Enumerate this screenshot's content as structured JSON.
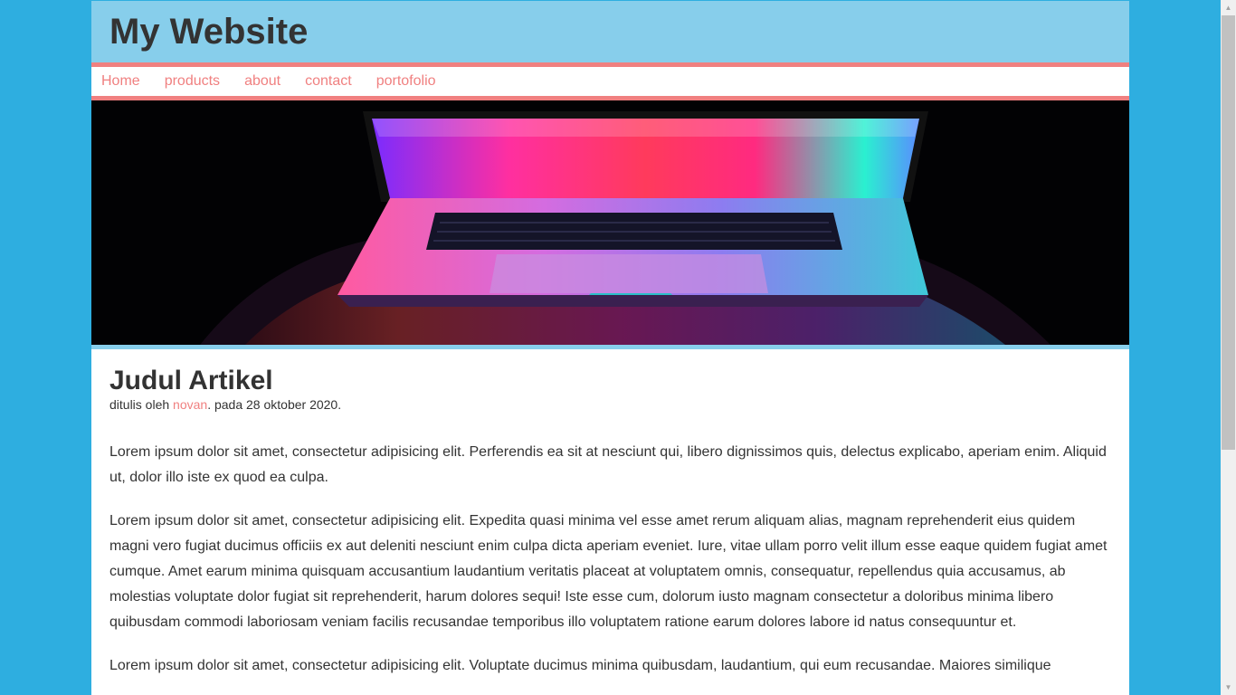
{
  "header": {
    "site_title": "My Website"
  },
  "nav": {
    "items": [
      {
        "label": "Home"
      },
      {
        "label": "products"
      },
      {
        "label": "about"
      },
      {
        "label": "contact"
      },
      {
        "label": "portofolio"
      }
    ]
  },
  "hero": {
    "image": "laptop-neon-photo"
  },
  "article": {
    "title": "Judul Artikel",
    "meta_prefix": "ditulis oleh ",
    "author": "novan",
    "meta_suffix": ". pada 28 oktober 2020.",
    "paragraphs": [
      "Lorem ipsum dolor sit amet, consectetur adipisicing elit. Perferendis ea sit at nesciunt qui, libero dignissimos quis, delectus explicabo, aperiam enim. Aliquid ut, dolor illo iste ex quod ea culpa.",
      "Lorem ipsum dolor sit amet, consectetur adipisicing elit. Expedita quasi minima vel esse amet rerum aliquam alias, magnam reprehenderit eius quidem magni vero fugiat ducimus officiis ex aut deleniti nesciunt enim culpa dicta aperiam eveniet. Iure, vitae ullam porro velit illum esse eaque quidem fugiat amet cumque. Amet earum minima quisquam accusantium laudantium veritatis placeat at voluptatem omnis, consequatur, repellendus quia accusamus, ab molestias voluptate dolor fugiat sit reprehenderit, harum dolores sequi! Iste esse cum, dolorum iusto magnam consectetur a doloribus minima libero quibusdam commodi laboriosam veniam facilis recusandae temporibus illo voluptatem ratione earum dolores labore id natus consequuntur et.",
      "Lorem ipsum dolor sit amet, consectetur adipisicing elit. Voluptate ducimus minima quibusdam, laudantium, qui eum recusandae. Maiores similique"
    ]
  },
  "colors": {
    "page_background": "#2eaee0",
    "header_background": "#87ceeb",
    "accent": "#f08080",
    "text": "#333333"
  }
}
